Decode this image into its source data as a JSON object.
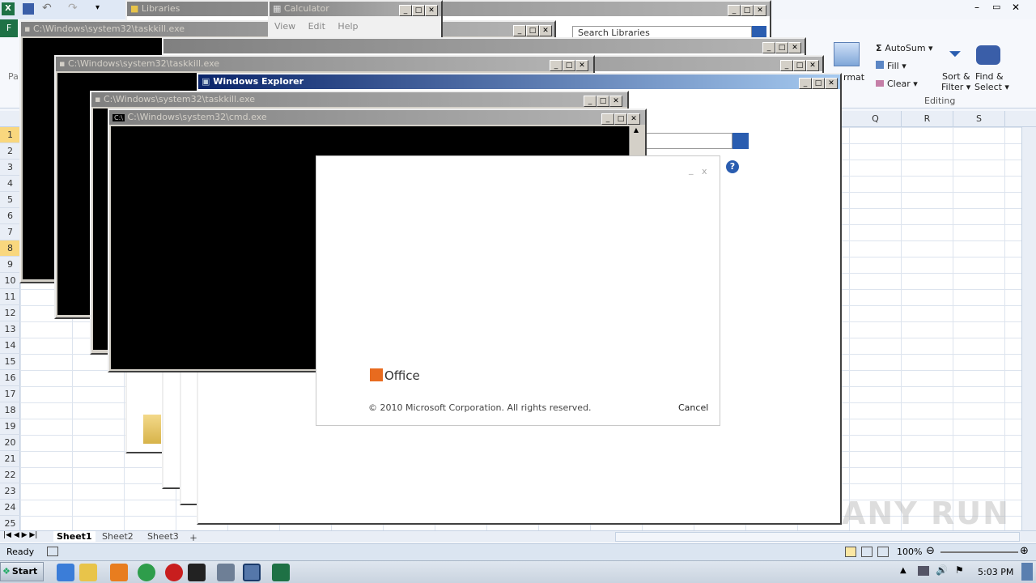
{
  "excel": {
    "tab_file": "F",
    "ribbon_left_label": "Pa",
    "editing": {
      "autosum": "AutoSum",
      "fill": "Fill",
      "clear": "Clear",
      "sort_filter_line1": "Sort &",
      "sort_filter_line2": "Filter",
      "find_select_line1": "Find &",
      "find_select_line2": "Select",
      "group_label": "Editing",
      "format_fragment": "rmat"
    },
    "columns": [
      "Q",
      "R",
      "S"
    ],
    "rows": [
      "1",
      "2",
      "3",
      "4",
      "5",
      "6",
      "7",
      "8",
      "9",
      "10",
      "11",
      "12",
      "13",
      "14",
      "15",
      "16",
      "17",
      "18",
      "19",
      "20",
      "21",
      "22",
      "23",
      "24",
      "25"
    ],
    "sheets": [
      "Sheet1",
      "Sheet2",
      "Sheet3"
    ],
    "status_ready": "Ready",
    "zoom": "100%"
  },
  "windows": {
    "libraries_title": "Libraries",
    "libraries_search": "Search Libraries",
    "calculator_title": "Calculator",
    "calculator_menu": [
      "View",
      "Edit",
      "Help"
    ],
    "taskkill_title": "C:\\Windows\\system32\\taskkill.exe",
    "explorer_title": "Windows Explorer",
    "cmd_title": "C:\\Windows\\system32\\cmd.exe"
  },
  "office_splash": {
    "logo_text": "Office",
    "copyright": "© 2010 Microsoft Corporation.  All rights reserved.",
    "cancel": "Cancel"
  },
  "taskbar": {
    "start": "Start",
    "clock": "5:03 PM"
  },
  "watermark": "ANY RUN"
}
